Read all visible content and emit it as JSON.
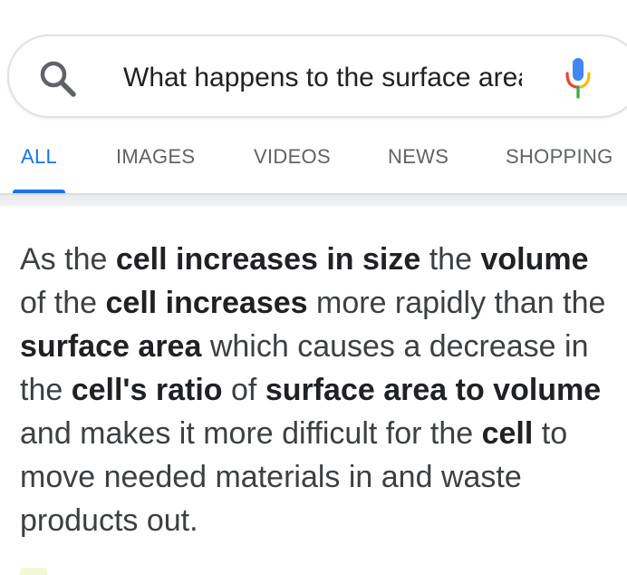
{
  "search": {
    "query": "What happens to the surface area of a cell as it grows"
  },
  "tabs": [
    {
      "label": "ALL",
      "active": true
    },
    {
      "label": "IMAGES",
      "active": false
    },
    {
      "label": "VIDEOS",
      "active": false
    },
    {
      "label": "NEWS",
      "active": false
    },
    {
      "label": "SHOPPING",
      "active": false
    }
  ],
  "answer": {
    "segments": [
      {
        "text": "As the ",
        "bold": false
      },
      {
        "text": "cell increases in size",
        "bold": true
      },
      {
        "text": " the ",
        "bold": false
      },
      {
        "text": "volume",
        "bold": true
      },
      {
        "text": " of the ",
        "bold": false
      },
      {
        "text": "cell increases",
        "bold": true
      },
      {
        "text": " more rapidly than the ",
        "bold": false
      },
      {
        "text": "surface area",
        "bold": true
      },
      {
        "text": " which causes a decrease in the ",
        "bold": false
      },
      {
        "text": "cell's ratio",
        "bold": true
      },
      {
        "text": " of ",
        "bold": false
      },
      {
        "text": "surface area to volume",
        "bold": true
      },
      {
        "text": " and makes it more difficult for the ",
        "bold": false
      },
      {
        "text": "cell",
        "bold": true
      },
      {
        "text": " to move needed materials in and waste products out.",
        "bold": false
      }
    ]
  },
  "colors": {
    "accent": "#1a73e8",
    "mic_blue": "#4285f4",
    "mic_red": "#ea4335",
    "mic_yellow": "#fbbc05",
    "mic_green": "#34a853"
  },
  "icons": {
    "search": "search-icon",
    "mic": "mic-icon"
  }
}
